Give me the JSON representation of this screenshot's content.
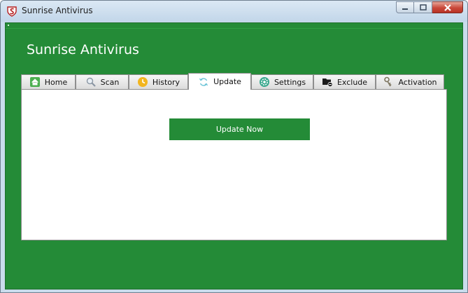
{
  "window": {
    "title": "Sunrise Antivirus"
  },
  "app": {
    "title": "Sunrise Antivirus"
  },
  "tabs": [
    {
      "label": "Home",
      "icon": "home-icon"
    },
    {
      "label": "Scan",
      "icon": "magnifier-icon"
    },
    {
      "label": "History",
      "icon": "history-icon"
    },
    {
      "label": "Update",
      "icon": "refresh-icon",
      "active": true
    },
    {
      "label": "Settings",
      "icon": "gear-icon"
    },
    {
      "label": "Exclude",
      "icon": "folder-minus-icon"
    },
    {
      "label": "Activation",
      "icon": "key-icon"
    }
  ],
  "update_panel": {
    "button_label": "Update Now"
  },
  "colors": {
    "brand_green": "#248b37",
    "tab_bg": "#e9e9e9",
    "close_red": "#c9483a"
  }
}
